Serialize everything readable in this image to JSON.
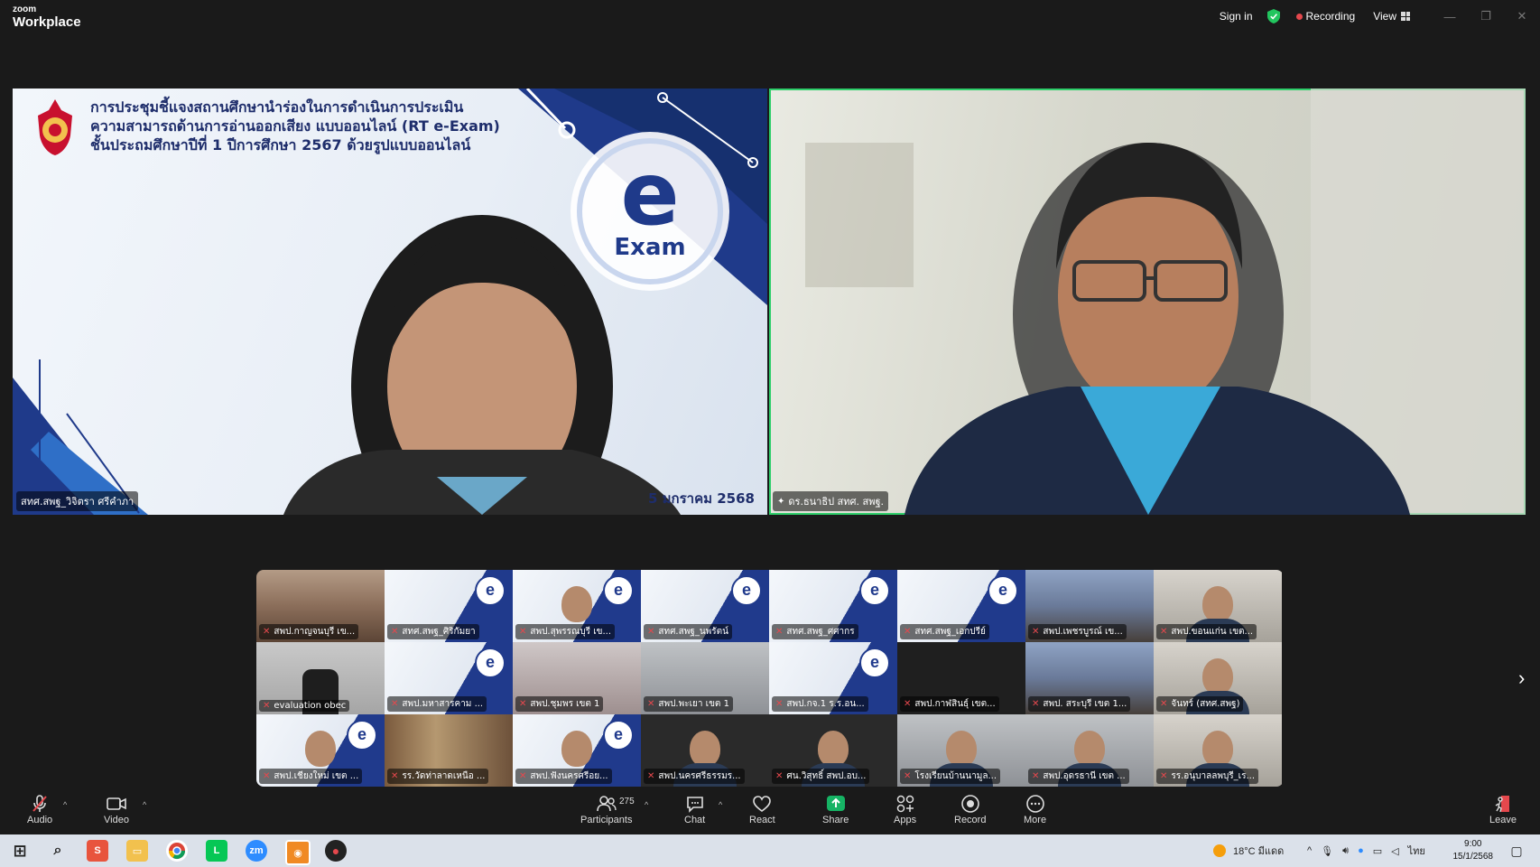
{
  "app": {
    "brand_small": "zoom",
    "brand_large": "Workplace"
  },
  "titlebar": {
    "sign_in": "Sign in",
    "recording": "Recording",
    "view": "View"
  },
  "main_videos": {
    "left": {
      "slide_title_lines": [
        "การประชุมชี้แจงสถานศึกษานำร่องในการดำเนินการประเมิน",
        "ความสามารถด้านการอ่านออกเสียง แบบออนไลน์ (RT e-Exam)",
        "ชั้นประถมศึกษาปีที่ 1 ปีการศึกษา 2567 ด้วยรูปแบบออนไลน์"
      ],
      "logo_text": "Exam",
      "date_text": "5 มกราคม 2568",
      "name": "สทศ.สพฐ_วิจิตรา ศรีคำภา"
    },
    "right": {
      "name": "ดร.ธนาธิป สทศ. สพฐ."
    }
  },
  "gallery": {
    "tiles": [
      {
        "name": "สพป.กาญจนบุรี เข...",
        "bg": "room"
      },
      {
        "name": "สทศ.สพฐ_ศิริกัมยา",
        "bg": "slide"
      },
      {
        "name": "สพป.สุพรรณบุรี เข...",
        "bg": "slide-face"
      },
      {
        "name": "สทศ.สพฐ_นพรัตน์",
        "bg": "slide"
      },
      {
        "name": "สทศ.สพฐ_ศศากร",
        "bg": "slide"
      },
      {
        "name": "สทศ.สพฐ_เอกปรีย์",
        "bg": "slide"
      },
      {
        "name": "สพป.เพชรบูรณ์ เข...",
        "bg": "hall"
      },
      {
        "name": "สพป.ขอนแก่น เขต...",
        "bg": "office-face"
      },
      {
        "name": "evaluation obec",
        "bg": "chair"
      },
      {
        "name": "สพป.มหาสารคาม ...",
        "bg": "slide"
      },
      {
        "name": "สพป.ชุมพร เขต 1",
        "bg": "pink"
      },
      {
        "name": "สพป.พะเยา เขต 1",
        "bg": "gray"
      },
      {
        "name": "สพป.กจ.1 ร.ร.อน...",
        "bg": "slide"
      },
      {
        "name": "สพป.กาฬสินธุ์ เขต...",
        "bg": "black"
      },
      {
        "name": "สพป. สระบุรี เขต 1...",
        "bg": "hall"
      },
      {
        "name": "จันทร์ (สทศ.สพฐ)",
        "bg": "office-face"
      },
      {
        "name": "สพป.เชียงใหม่ เขต ...",
        "bg": "slide-face"
      },
      {
        "name": "รร.วัดท่าลาดเหนือ ...",
        "bg": "shelf"
      },
      {
        "name": "สพป.ฟังนครศรีอย...",
        "bg": "slide-face"
      },
      {
        "name": "สพป.นครศรีธรรมร...",
        "bg": "dark-face"
      },
      {
        "name": "ศน.วิสุทธิ์ สพป.อบ...",
        "bg": "dark-face"
      },
      {
        "name": "โรงเรียนบ้านนามูล...",
        "bg": "gray-face"
      },
      {
        "name": "สพป.อุดรธานี เขต ...",
        "bg": "gray-face"
      },
      {
        "name": "รร.อนุบาลลพบุรี_เร...",
        "bg": "office-face"
      }
    ]
  },
  "toolbar": {
    "audio": "Audio",
    "video": "Video",
    "participants": "Participants",
    "participants_count": "275",
    "chat": "Chat",
    "react": "React",
    "share": "Share",
    "apps": "Apps",
    "record": "Record",
    "more": "More",
    "leave": "Leave",
    "share_color": "#16b364"
  },
  "taskbar": {
    "weather": "18°C มีแดด",
    "lang": "ไทย",
    "time": "9:00",
    "date": "15/1/2568"
  }
}
